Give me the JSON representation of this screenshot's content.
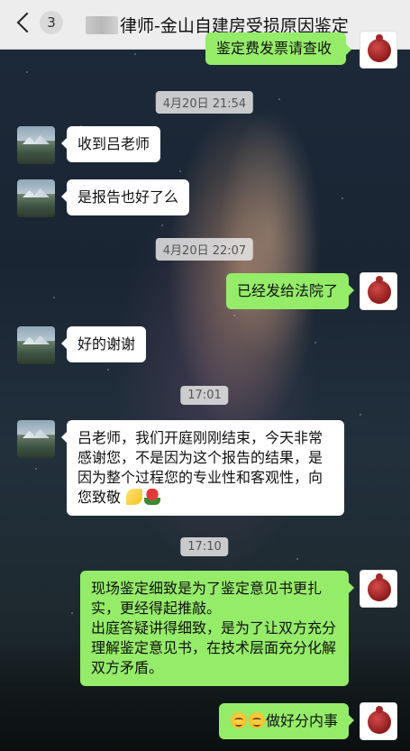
{
  "header": {
    "unread_count": "3",
    "title": "律师-金山自建房受损原因鉴定"
  },
  "messages": {
    "m0": {
      "text": "鉴定费发票请查收"
    },
    "t1": {
      "text": "4月20日 21:54"
    },
    "m1": {
      "text": "收到吕老师"
    },
    "m2": {
      "text": "是报告也好了么"
    },
    "t2": {
      "text": "4月20日 22:07"
    },
    "m3": {
      "text": "已经发给法院了"
    },
    "m4": {
      "text": "好的谢谢"
    },
    "t3": {
      "text": "17:01"
    },
    "m5": {
      "text": "吕老师，我们开庭刚刚结束，今天非常感谢您，不是因为这个报告的结果，是因为整个过程您的专业性和客观性，向您致敬"
    },
    "t4": {
      "text": "17:10"
    },
    "m6": {
      "line1": "现场鉴定细致是为了鉴定意见书更扎实，更经得起推敲。",
      "line2": "出庭答疑讲得细致，是为了让双方充分理解鉴定意见书，在技术层面充分化解双方矛盾。"
    },
    "m7": {
      "text": "做好分内事"
    }
  },
  "icons": {
    "back": "chevron-left-icon",
    "banana": "banana-emoji",
    "rose": "rose-emoji",
    "grin": "grinning-face-emoji"
  },
  "colors": {
    "bubble_self": "#95ec69",
    "bubble_other": "#ffffff",
    "topbar": "#ededed"
  }
}
